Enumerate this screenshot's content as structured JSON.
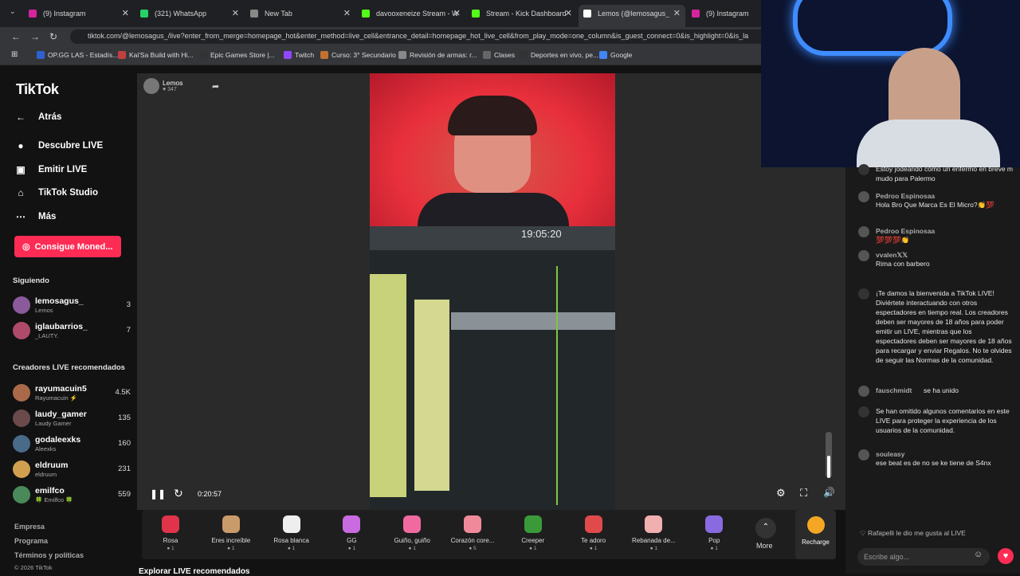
{
  "tabs": [
    {
      "label": "(9) Instagram",
      "color": "#d6249f"
    },
    {
      "label": "(321) WhatsApp",
      "color": "#25d366"
    },
    {
      "label": "New Tab",
      "color": "#888888"
    },
    {
      "label": "davooxeneize Stream - W",
      "color": "#53fc18"
    },
    {
      "label": "Stream - Kick Dashboard",
      "color": "#53fc18"
    },
    {
      "label": "Lemos (@lemosagus_",
      "color": "#ffffff"
    },
    {
      "label": "(9) Instagram",
      "color": "#d6249f"
    }
  ],
  "url": "tiktok.com/@lemosagus_/live?enter_from_merge=homepage_hot&enter_method=live_cell&entrance_detail=homepage_hot_live_cell&from_play_mode=one_column&is_guest_connect=0&is_highlight=0&is_la",
  "bookmarks": [
    "OP.GG LAS - Estadís...",
    "Kai'Sa Build with Hi...",
    "Epic Games Store |...",
    "Twitch",
    "Curso: 3° Secundario",
    "Revisión de armas: r...",
    "Clases",
    "Deportes en vivo, pe...",
    "Google"
  ],
  "sidebar": {
    "logo": "TikTok",
    "back": "Atrás",
    "menu": [
      "Descubre LIVE",
      "Emitir LIVE",
      "TikTok Studio",
      "Más"
    ],
    "coins": "Consigue Moned...",
    "following_title": "Siguiendo",
    "following": [
      {
        "name": "lemosagus_",
        "sub": "Lemos",
        "count": "3"
      },
      {
        "name": "iglaubarrios_",
        "sub": "_LAUTY.",
        "count": "7"
      }
    ],
    "rec_title": "Creadores LIVE recomendados",
    "recommended": [
      {
        "name": "rayumacuin5",
        "sub": "Rayumacuin ⚡",
        "count": "4.5K"
      },
      {
        "name": "laudy_gamer",
        "sub": "Laudy Gamer",
        "count": "135"
      },
      {
        "name": "godaleexks",
        "sub": "Aleexks",
        "count": "160"
      },
      {
        "name": "eldruum",
        "sub": "eldruum",
        "count": "231"
      },
      {
        "name": "emilfco",
        "sub": "🍀 Emilfco 🍀",
        "count": "559"
      }
    ],
    "footer": [
      "Empresa",
      "Programa",
      "Términos y políticas",
      "© 2026 TikTok"
    ]
  },
  "host": {
    "name": "Lemos",
    "likes": "347"
  },
  "player": {
    "time": "0:20:57",
    "daw_clock": "19:05:20"
  },
  "gifts": [
    {
      "name": "Rosa",
      "price": "1",
      "color": "#e0344a"
    },
    {
      "name": "Eres increíble",
      "price": "1",
      "color": "#c99a6a"
    },
    {
      "name": "Rosa blanca",
      "price": "1",
      "color": "#eeeeee"
    },
    {
      "name": "GG",
      "price": "1",
      "color": "#c86ae0"
    },
    {
      "name": "Guiño, guiño",
      "price": "1",
      "color": "#f06aa0"
    },
    {
      "name": "Corazón core...",
      "price": "5",
      "color": "#f08a9a"
    },
    {
      "name": "Creeper",
      "price": "1",
      "color": "#3a9a3a"
    },
    {
      "name": "Te adoro",
      "price": "1",
      "color": "#e04a4a"
    },
    {
      "name": "Rebanada de...",
      "price": "1",
      "color": "#f0b0b0"
    },
    {
      "name": "Pop",
      "price": "1",
      "color": "#8a6ae0"
    }
  ],
  "more": "More",
  "recharge": "Recharge",
  "chat": [
    {
      "user": "",
      "text": "Estoy jodeando como un enfermo en breve m mudo para Palermo"
    },
    {
      "user": "Pedroo Espinosaa",
      "text": "Hola Bro Que Marca Es El Micro?👏💯"
    },
    {
      "user": "Pedroo Espinosaa",
      "text": "💯💯💯👏"
    },
    {
      "user": "vvalen𝕏𝕏",
      "text": "Rima con barbero"
    },
    {
      "user": "",
      "text": "¡Te damos la bienvenida a TikTok LIVE! Diviértete interactuando con otros espectadores en tiempo real. Los creadores deben ser mayores de 18 años para poder emitir un LIVE, mientras que los espectadores deben ser mayores de 18 años para recargar y enviar Regalos. No te olvides de seguir las Normas de la comunidad."
    },
    {
      "user": "fauschmidt",
      "text": "se ha unido"
    },
    {
      "user": "",
      "text": "Se han omitido algunos comentarios en este LIVE para proteger la experiencia de los usuarios de la comunidad."
    },
    {
      "user": "souleasy",
      "text": "ese beat es de no se ke tiene de S4nx"
    }
  ],
  "chat_like": "Rafapelli le dio me gusta al LIVE",
  "chat_placeholder": "Escribe algo...",
  "below": "Explorar LIVE recomendados"
}
